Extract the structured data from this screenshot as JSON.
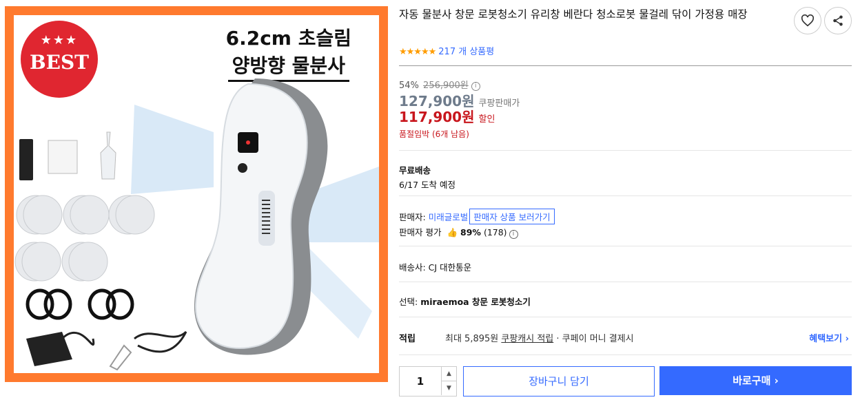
{
  "product_image": {
    "badge": {
      "stars": "★★★",
      "label": "BEST"
    },
    "promo_line1": "6.2cm 초슬림",
    "promo_line2": "양방향 물분사"
  },
  "title": "자동 물분사 창문 로봇청소기 유리창 베란다 청소로봇 물걸레 닦이 가정용 매장",
  "rating": {
    "stars": "★★★★★",
    "reviews": "217 개 상품평"
  },
  "price": {
    "discount_rate": "54%",
    "original": "256,900원",
    "coupang_price": "127,900원",
    "coupang_label": "쿠팡판매가",
    "sale_price": "117,900원",
    "sale_label": "할인",
    "stock_note": "품절임박 (6개 남음)"
  },
  "shipping": {
    "free": "무료배송",
    "arrival": "6/17 도착 예정"
  },
  "seller": {
    "prefix": "판매자: ",
    "name": "미래글로벌",
    "view_button": "판매자 상품 보러가기",
    "score_label": "판매자 평가",
    "score_percent": "89%",
    "score_count": "(178)"
  },
  "carrier": "배송사:  CJ 대한통운",
  "option": {
    "prefix": "선택: ",
    "value": "miraemoa 창문 로봇청소기"
  },
  "earn": {
    "label": "적립",
    "text_pre": "최대 5,895원 ",
    "link": "쿠팡캐시 적립",
    "text_post": " · 쿠페이 머니 결제시",
    "benefit": "혜택보기"
  },
  "purchase": {
    "quantity": "1",
    "cart_label": "장바구니 담기",
    "buy_label": "바로구매"
  },
  "colors": {
    "accent": "#346aff",
    "sale": "#c8161d",
    "frame": "#ff7a2e",
    "badge": "#e02630"
  }
}
